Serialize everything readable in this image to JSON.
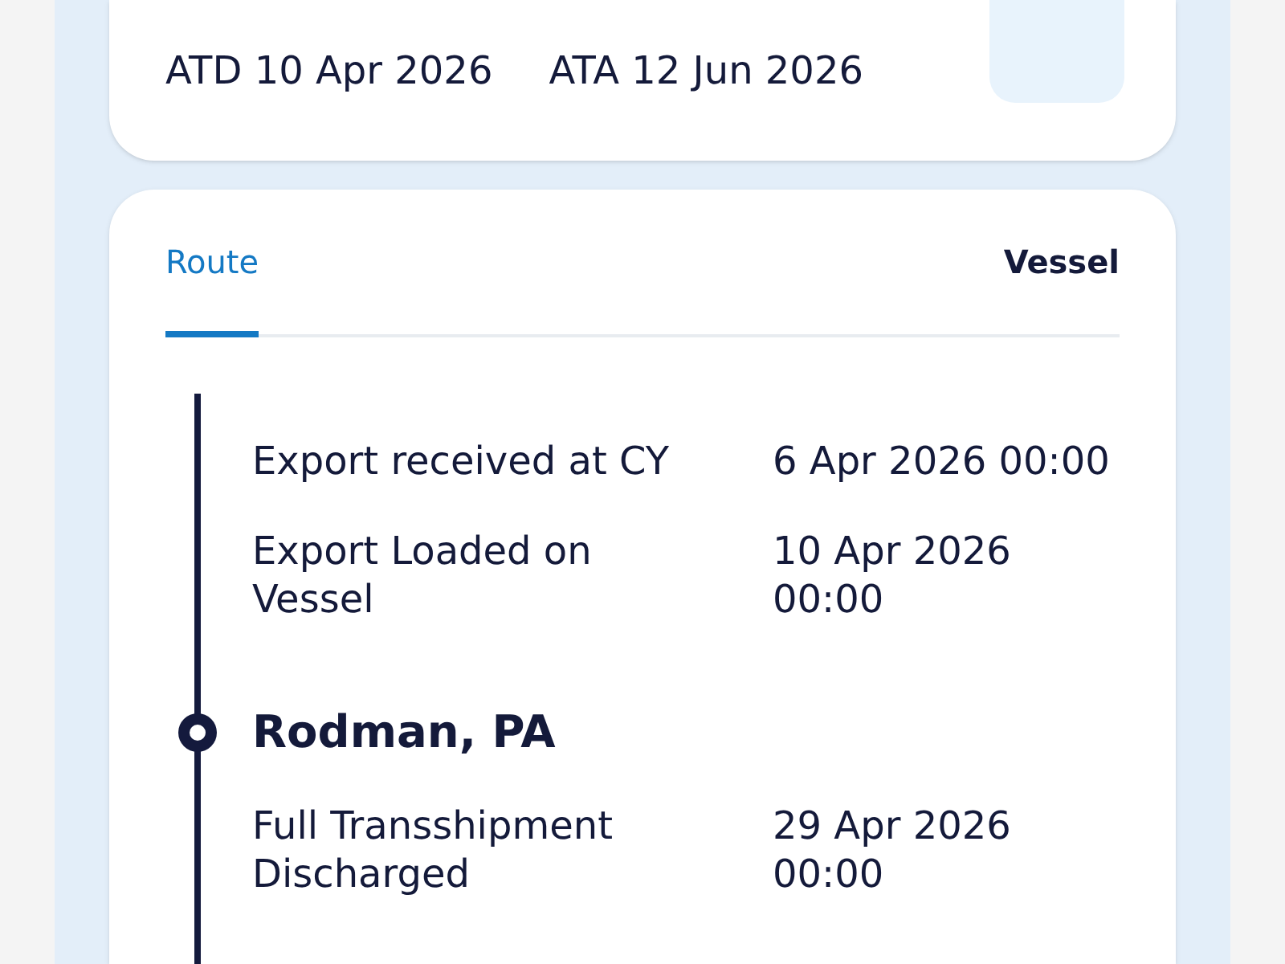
{
  "voyage": {
    "departure": "ATD 10 Apr 2026",
    "arrival": "ATA 12 Jun 2026"
  },
  "tabs": [
    {
      "label": "Route",
      "selected": true
    },
    {
      "label": "Vessel",
      "selected": false
    }
  ],
  "route": [
    {
      "kind": "event",
      "event": "Export received at CY",
      "time": "6 Apr 2026 00:00"
    },
    {
      "kind": "event",
      "event": "Export Loaded on Vessel",
      "time": "10 Apr 2026 00:00"
    },
    {
      "kind": "location",
      "name": "Rodman, PA"
    },
    {
      "kind": "event",
      "event": "Full Transshipment Discharged",
      "time": "29 Apr 2026 00:00"
    }
  ]
}
